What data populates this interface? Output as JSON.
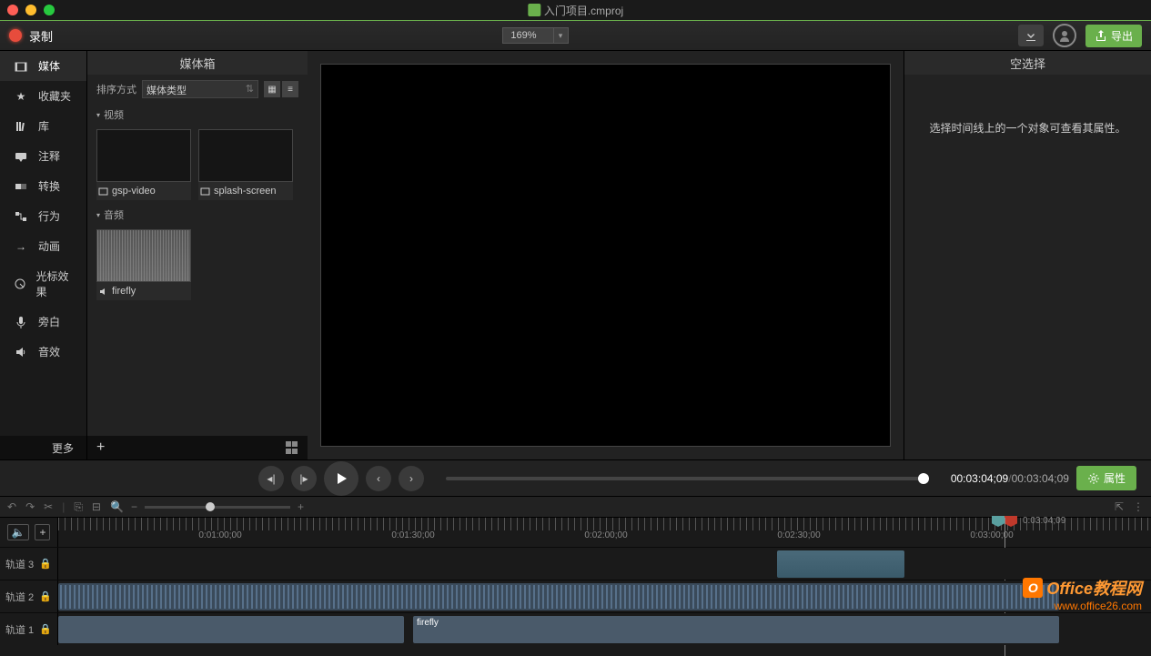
{
  "titlebar": {
    "filename": "入门项目.cmproj"
  },
  "toolbar": {
    "record": "录制",
    "zoom": "169%",
    "export": "导出"
  },
  "sidebar": {
    "items": [
      {
        "label": "媒体",
        "icon": "media"
      },
      {
        "label": "收藏夹",
        "icon": "star"
      },
      {
        "label": "库",
        "icon": "library"
      },
      {
        "label": "注释",
        "icon": "annotation"
      },
      {
        "label": "转换",
        "icon": "transition"
      },
      {
        "label": "行为",
        "icon": "behavior"
      },
      {
        "label": "动画",
        "icon": "animation"
      },
      {
        "label": "光标效果",
        "icon": "cursor"
      },
      {
        "label": "旁白",
        "icon": "mic"
      },
      {
        "label": "音效",
        "icon": "audio"
      }
    ],
    "more": "更多"
  },
  "mediabin": {
    "title": "媒体箱",
    "sort_label": "排序方式",
    "sort_value": "媒体类型",
    "section_video": "视频",
    "section_audio": "音频",
    "items": {
      "video1": "gsp-video",
      "video2": "splash-screen",
      "audio1": "firefly"
    }
  },
  "properties": {
    "title": "空选择",
    "hint": "选择时间线上的一个对象可查看其属性。"
  },
  "playback": {
    "current_time": "00:03:04;09",
    "total_time": "00:03:04;09",
    "props_btn": "属性"
  },
  "timeline": {
    "end_time": "0:03:04;09",
    "ruler": [
      "0:01:00;00",
      "0:01:30;00",
      "0:02:00;00",
      "0:02:30;00",
      "0:03:00;00"
    ],
    "tracks": {
      "t3": "轨道 3",
      "t2": "轨道 2",
      "t1": "轨道 1"
    },
    "clip_firefly": "firefly"
  },
  "watermark": {
    "line1": "Office教程网",
    "line2": "www.office26.com"
  }
}
